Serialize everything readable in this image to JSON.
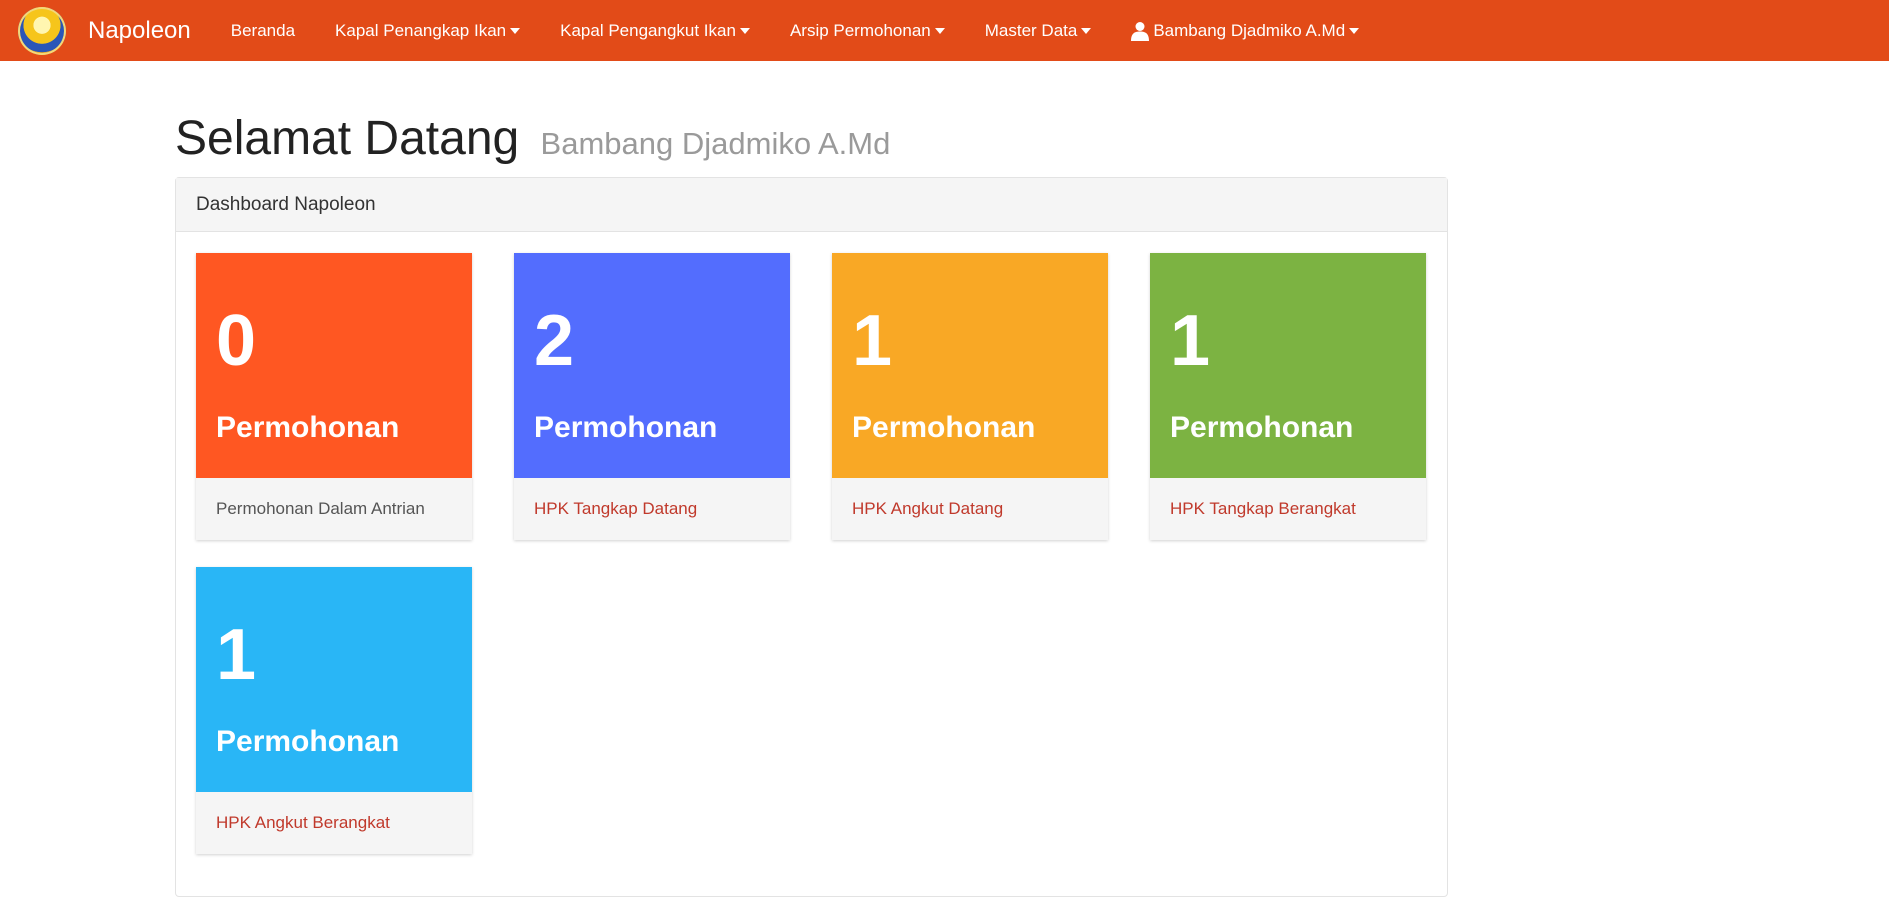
{
  "navbar": {
    "brand": "Napoleon",
    "logo_icon": "app-logo",
    "items": [
      {
        "label": "Beranda",
        "dropdown": false
      },
      {
        "label": "Kapal Penangkap Ikan",
        "dropdown": true
      },
      {
        "label": "Kapal Pengangkut Ikan",
        "dropdown": true
      },
      {
        "label": "Arsip Permohonan",
        "dropdown": true
      },
      {
        "label": "Master Data",
        "dropdown": true
      }
    ],
    "user": {
      "label": "Bambang Djadmiko A.Md",
      "icon": "user-icon",
      "dropdown": true
    },
    "color": "#e24b18"
  },
  "page": {
    "title": "Selamat Datang",
    "subtitle": "Bambang Djadmiko A.Md"
  },
  "panel": {
    "heading": "Dashboard Napoleon",
    "cards": [
      {
        "count": "0",
        "label": "Permohonan",
        "footer": "Permohonan Dalam Antrian",
        "color": "#ff5722",
        "footer_color": "grey"
      },
      {
        "count": "2",
        "label": "Permohonan",
        "footer": "HPK Tangkap Datang",
        "color": "#536dfe",
        "footer_color": "red"
      },
      {
        "count": "1",
        "label": "Permohonan",
        "footer": "HPK Angkut Datang",
        "color": "#f9a825",
        "footer_color": "red"
      },
      {
        "count": "1",
        "label": "Permohonan",
        "footer": "HPK Tangkap Berangkat",
        "color": "#7cb342",
        "footer_color": "red"
      },
      {
        "count": "1",
        "label": "Permohonan",
        "footer": "HPK Angkut Berangkat",
        "color": "#29b6f6",
        "footer_color": "red"
      }
    ]
  }
}
